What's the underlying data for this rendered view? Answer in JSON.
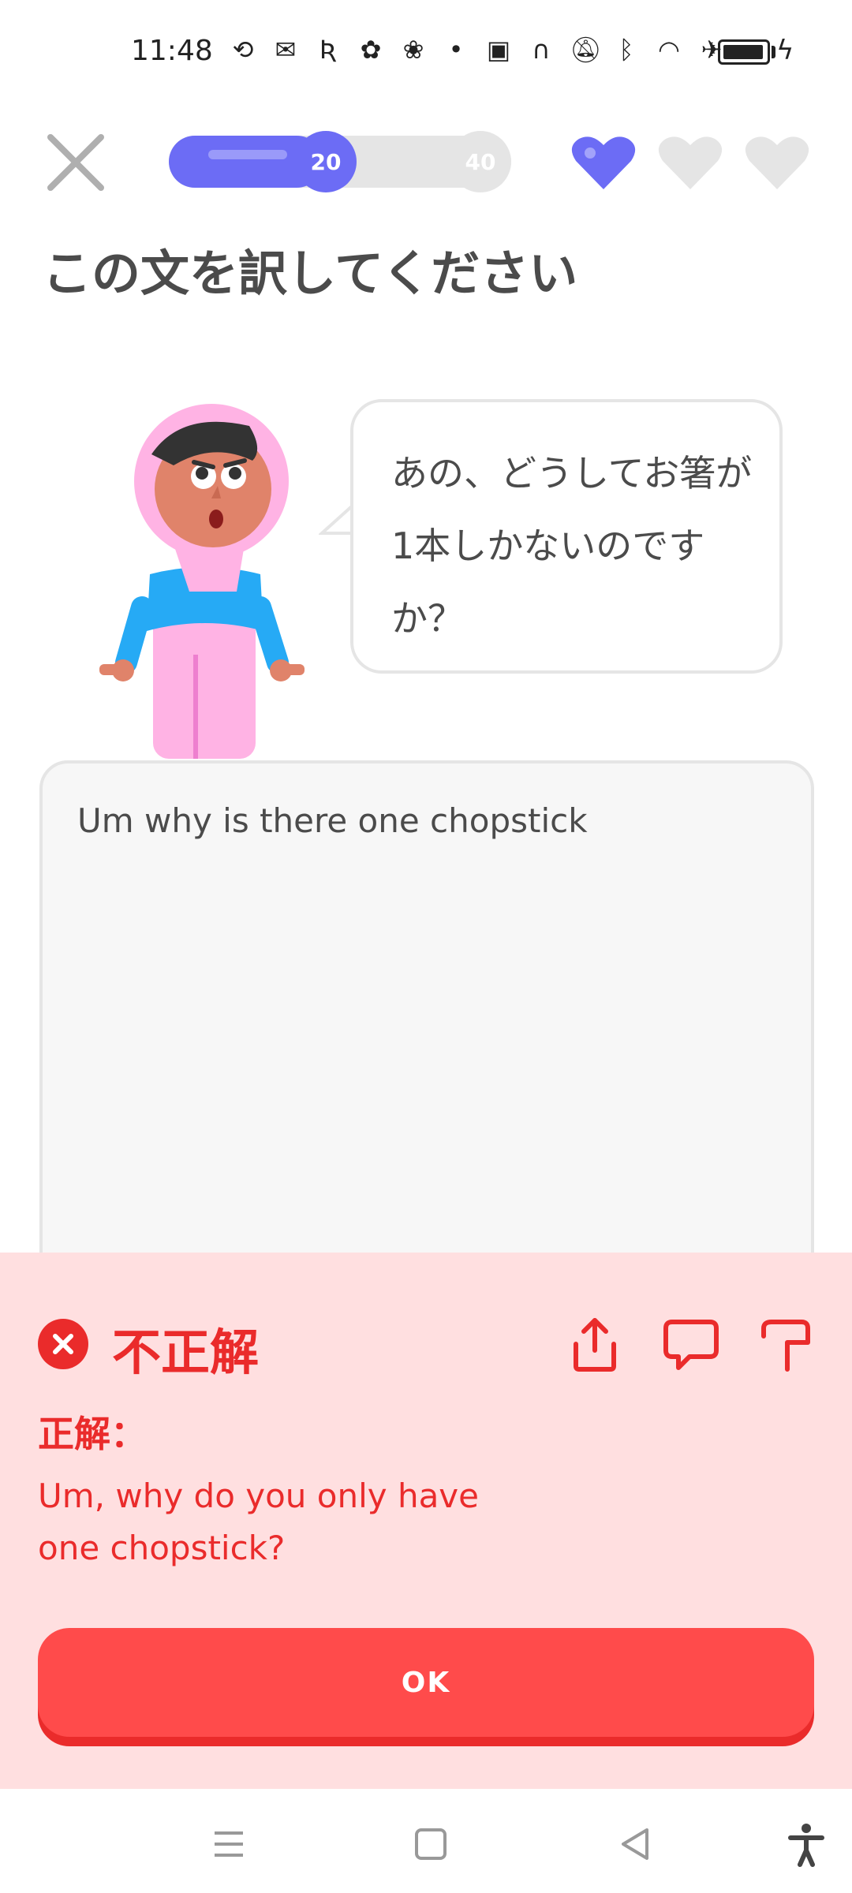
{
  "status_bar": {
    "time": "11:48",
    "icons": [
      "sync-icon",
      "gmail-icon",
      "r-icon",
      "app-icon",
      "app-icon-2",
      "dot-icon",
      "nfc-icon",
      "headphones-icon",
      "mute-icon",
      "bluetooth-icon",
      "wifi-icon",
      "airplane-icon",
      "battery-icon",
      "charging-icon"
    ]
  },
  "header": {
    "progress": {
      "fill_fraction": 0.45,
      "milestones": [
        "20",
        "40"
      ]
    },
    "hearts": {
      "total": 3,
      "filled": 1,
      "filled_color": "#6c6cf5",
      "empty_color": "#e5e5e5"
    }
  },
  "prompt": {
    "title": "この文を訳してください",
    "speech": "あの、どうしてお箸が1本しかないのですか？"
  },
  "answer": {
    "text": "Um why is there one chopstick"
  },
  "feedback": {
    "status": "不正解",
    "label": "正解：",
    "correct_answer": "Um, why do you only have one chopstick?",
    "ok_label": "OK",
    "colors": {
      "background": "#ffdfe0",
      "accent": "#ea2b2b",
      "button": "#ff4b4b"
    }
  },
  "nav_bar": {
    "items": [
      "menu-icon",
      "home-icon",
      "back-icon",
      "accessibility-icon"
    ]
  }
}
